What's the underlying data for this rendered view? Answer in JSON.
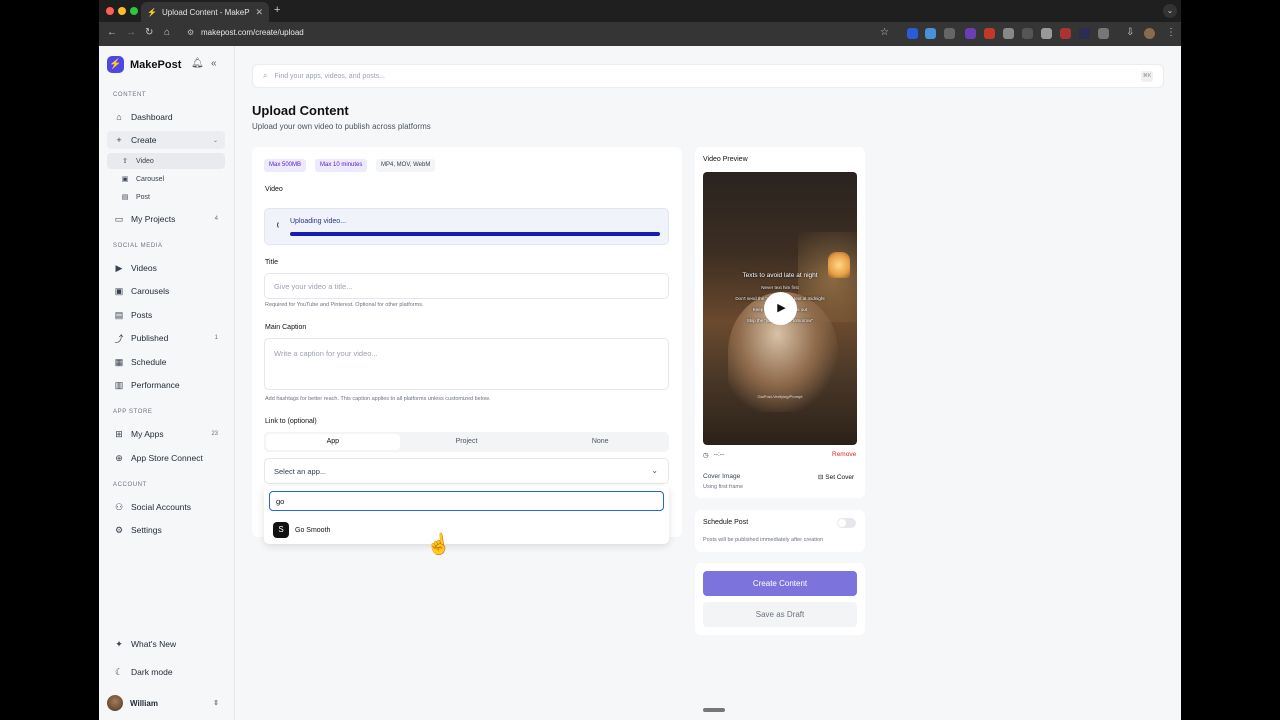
{
  "browser": {
    "tab_title": "Upload Content - MakePost",
    "url": "makepost.com/create/upload"
  },
  "sidebar": {
    "brand": "MakePost",
    "sections": {
      "content": "CONTENT",
      "social": "SOCIAL MEDIA",
      "appstore": "APP STORE",
      "account": "ACCOUNT"
    },
    "items": {
      "dashboard": "Dashboard",
      "create": "Create",
      "video": "Video",
      "carousel": "Carousel",
      "post": "Post",
      "my_projects": "My Projects",
      "my_projects_count": "4",
      "videos": "Videos",
      "carousels": "Carousels",
      "posts": "Posts",
      "published": "Published",
      "published_count": "1",
      "schedule": "Schedule",
      "performance": "Performance",
      "my_apps": "My Apps",
      "my_apps_count": "23",
      "app_store_connect": "App Store Connect",
      "social_accounts": "Social Accounts",
      "settings": "Settings",
      "whats_new": "What's New",
      "dark_mode": "Dark mode"
    },
    "user": "William"
  },
  "search": {
    "placeholder": "Find your apps, videos, and posts..."
  },
  "page": {
    "title": "Upload Content",
    "subtitle": "Upload your own video to publish across platforms"
  },
  "form": {
    "chips": [
      "Max 500MB",
      "Max 10 minutes",
      "MP4, MOV, WebM"
    ],
    "video_label": "Video",
    "uploading_text": "Uploading video...",
    "upload_progress": 1.0,
    "title_label": "Title",
    "title_placeholder": "Give your video a title...",
    "title_hint": "Required for YouTube and Pinterest. Optional for other platforms.",
    "caption_label": "Main Caption",
    "caption_placeholder": "Write a caption for your video...",
    "caption_hint": "Add hashtags for better reach. This caption applies to all platforms unless customized below.",
    "link_label": "Link to (optional)",
    "link_options": [
      "App",
      "Project",
      "None"
    ],
    "select_placeholder": "Select an app...",
    "search_value": "go",
    "result_app": "Go Smooth"
  },
  "preview": {
    "label": "Video Preview",
    "overlay_title": "Texts to avoid late at night",
    "overlay_lines": [
      "Never text him first",
      "Don't send the \"what are we\" text at midnight",
      "Keep it light, don't freak out",
      "Skip the \"just plans for tomorrow\""
    ],
    "watermark": "GiaPost-Verifying/Prompt",
    "time": "--:--",
    "remove": "Remove",
    "cover_label": "Cover Image",
    "cover_hint": "Using first frame",
    "set_cover": "Set Cover",
    "schedule_label": "Schedule Post",
    "schedule_hint": "Posts will be published immediately after creation",
    "create_button": "Create Content",
    "draft_button": "Save as Draft"
  }
}
